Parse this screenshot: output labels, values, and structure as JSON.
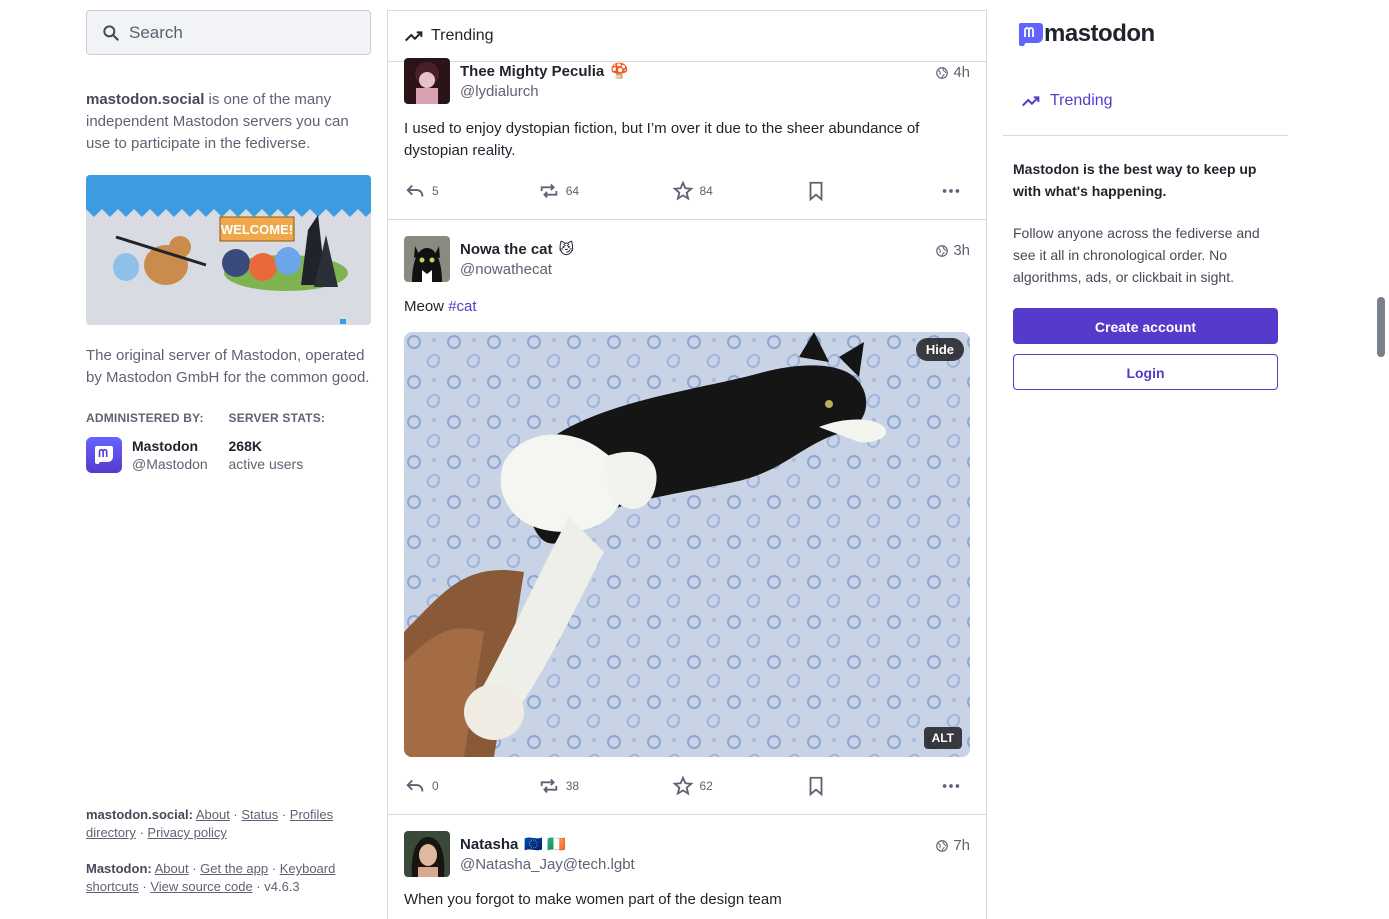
{
  "search": {
    "placeholder": "Search"
  },
  "server": {
    "domain": "mastodon.social",
    "intro_rest": " is one of the many independent Mastodon servers you can use to participate in the fediverse.",
    "description": "The original server of Mastodon, operated by Mastodon GmbH for the common good.",
    "admin_label": "ADMINISTERED BY:",
    "admin_name": "Mastodon",
    "admin_handle": "@Mastodon",
    "stats_label": "SERVER STATS:",
    "stats_value": "268K",
    "stats_unit": "active users",
    "banner_text": "WELCOME!"
  },
  "footer": {
    "server_prefix": "mastodon.social:",
    "server_links": [
      "About",
      "Status",
      "Profiles directory",
      "Privacy policy"
    ],
    "app_prefix": "Mastodon:",
    "app_links": [
      "About",
      "Get the app",
      "Keyboard shortcuts",
      "View source code"
    ],
    "version": "v4.6.3"
  },
  "column": {
    "title": "Trending"
  },
  "posts": [
    {
      "display_name": "Thee Mighty Peculia",
      "emoji": "🍄",
      "handle": "@lydialurch",
      "time": "4h",
      "content": "I used to enjoy dystopian fiction, but I’m over it due to the sheer abundance of dystopian reality.",
      "replies": "5",
      "boosts": "64",
      "favourites": "84"
    },
    {
      "display_name": "Nowa the cat",
      "emoji": "😼",
      "handle": "@nowathecat",
      "time": "3h",
      "content": "Meow ",
      "hashtag": "#cat",
      "hide_label": "Hide",
      "alt_label": "ALT",
      "replies": "0",
      "boosts": "38",
      "favourites": "62"
    },
    {
      "display_name": "Natasha",
      "emoji": "🇪🇺 🇮🇪",
      "handle": "@Natasha_Jay@tech.lgbt",
      "time": "7h",
      "content": "When you forgot to make women part of the design team"
    }
  ],
  "sidebar": {
    "logo_text": "mastodon",
    "nav_trending": "Trending",
    "signup_heading": "Mastodon is the best way to keep up with what's happening.",
    "signup_body": "Follow anyone across the fediverse and see it all in chronological order. No algorithms, ads, or clickbait in sight.",
    "create_account": "Create account",
    "login": "Login"
  },
  "colors": {
    "accent": "#563acc",
    "text": "#1f232b",
    "muted": "#5e6373",
    "border": "#d6d9e1"
  }
}
